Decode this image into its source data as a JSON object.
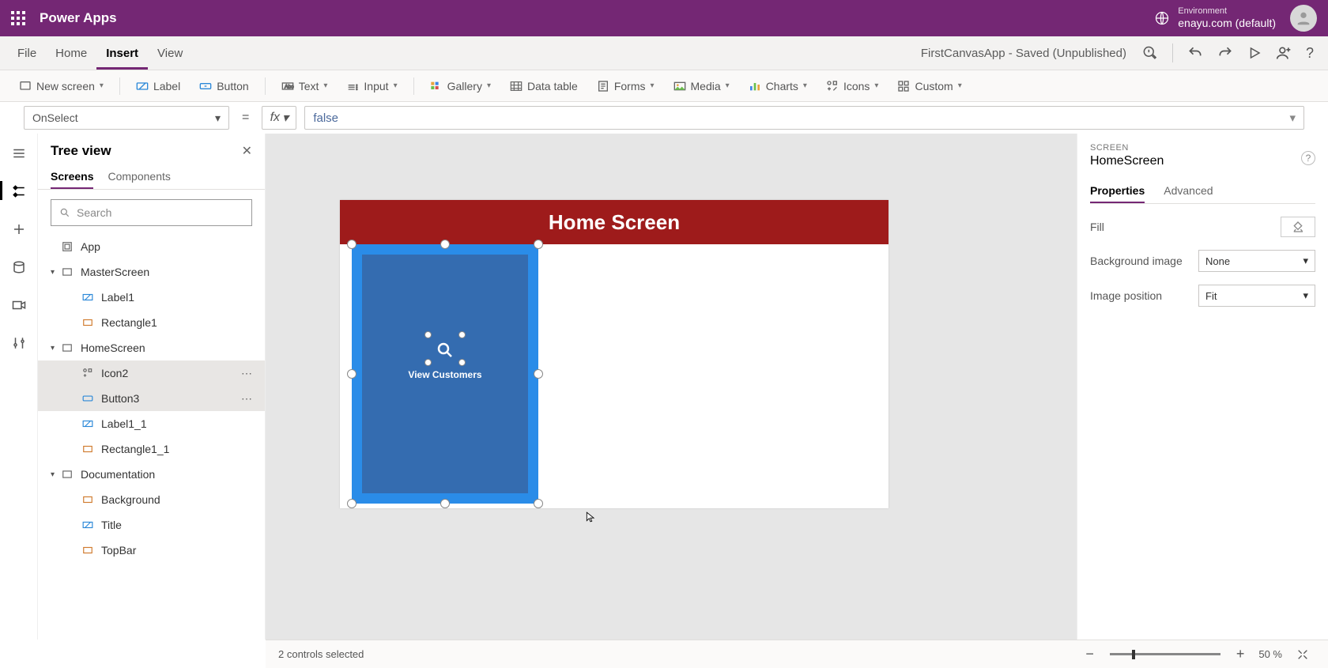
{
  "header": {
    "app_title": "Power Apps",
    "env_label": "Environment",
    "env_name": "enayu.com (default)"
  },
  "menubar": {
    "items": [
      "File",
      "Home",
      "Insert",
      "View"
    ],
    "active": "Insert",
    "status": "FirstCanvasApp - Saved (Unpublished)"
  },
  "ribbon": {
    "new_screen": "New screen",
    "label": "Label",
    "button": "Button",
    "text": "Text",
    "input": "Input",
    "gallery": "Gallery",
    "data_table": "Data table",
    "forms": "Forms",
    "media": "Media",
    "charts": "Charts",
    "icons": "Icons",
    "custom": "Custom"
  },
  "formula": {
    "property": "OnSelect",
    "expression": "false"
  },
  "tree": {
    "title": "Tree view",
    "tabs": [
      "Screens",
      "Components"
    ],
    "active_tab": "Screens",
    "search_placeholder": "Search",
    "nodes": {
      "app": "App",
      "master": "MasterScreen",
      "label1": "Label1",
      "rect1": "Rectangle1",
      "home": "HomeScreen",
      "icon2": "Icon2",
      "button3": "Button3",
      "label1_1": "Label1_1",
      "rect1_1": "Rectangle1_1",
      "doc": "Documentation",
      "background": "Background",
      "title": "Title",
      "topbar": "TopBar"
    }
  },
  "canvas": {
    "header_text": "Home Screen",
    "button_label": "View Customers"
  },
  "props": {
    "type": "SCREEN",
    "name": "HomeScreen",
    "tabs": [
      "Properties",
      "Advanced"
    ],
    "active_tab": "Properties",
    "fill": "Fill",
    "bg_image": "Background image",
    "bg_image_value": "None",
    "img_pos": "Image position",
    "img_pos_value": "Fit"
  },
  "statusbar": {
    "selection": "2 controls selected",
    "zoom": "50  %"
  }
}
